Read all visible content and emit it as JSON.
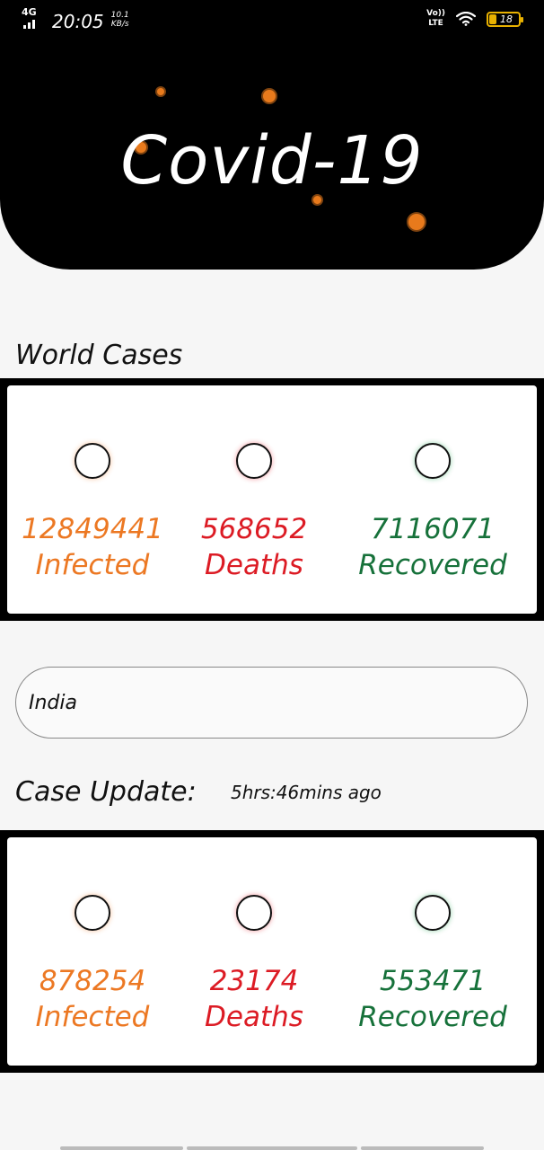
{
  "status_bar": {
    "network": "4G",
    "time": "20:05",
    "speed_value": "10.1",
    "speed_unit": "KB/s",
    "volte": "Vo))",
    "lte": "LTE",
    "battery": "18"
  },
  "header": {
    "title": "Covid-19",
    "accent_color": "#e87a1c"
  },
  "world": {
    "heading": "World Cases",
    "infected_count": "12849441",
    "infected_label": "Infected",
    "deaths_count": "568652",
    "deaths_label": "Deaths",
    "recovered_count": "7116071",
    "recovered_label": "Recovered"
  },
  "country_search": {
    "value": "India"
  },
  "country": {
    "heading": "Case Update:",
    "updated": "5hrs:46mins ago",
    "infected_count": "878254",
    "infected_label": "Infected",
    "deaths_count": "23174",
    "deaths_label": "Deaths",
    "recovered_count": "553471",
    "recovered_label": "Recovered"
  },
  "colors": {
    "infected": "#ec7823",
    "deaths": "#dc1b24",
    "recovered": "#16713a"
  }
}
